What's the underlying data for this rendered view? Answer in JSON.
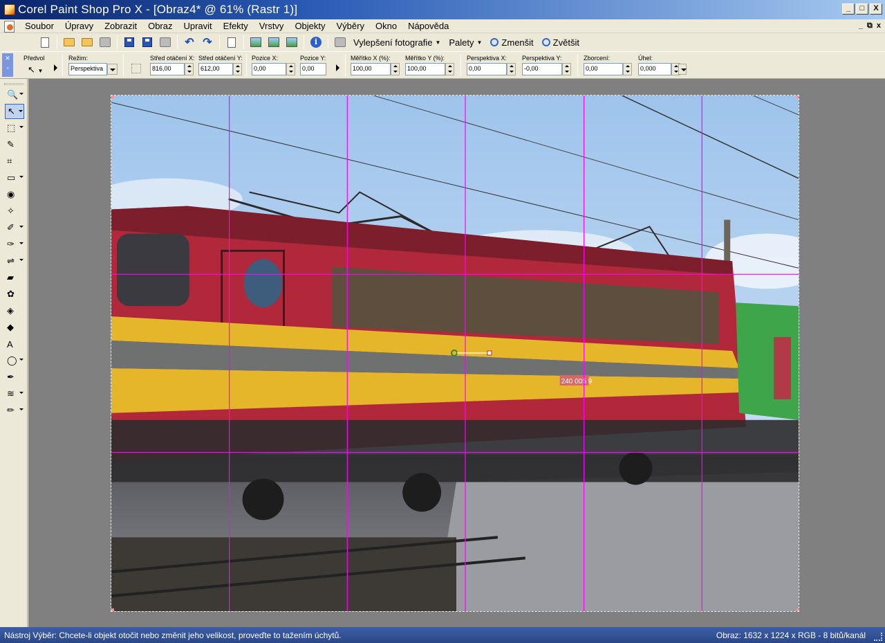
{
  "window": {
    "title": "Corel Paint Shop Pro X - [Obraz4* @  61% (Rastr 1)]",
    "min_label": "_",
    "max_label": "□",
    "close_label": "X"
  },
  "menu": {
    "items": [
      "Soubor",
      "Úpravy",
      "Zobrazit",
      "Obraz",
      "Upravit",
      "Efekty",
      "Vrstvy",
      "Objekty",
      "Výběry",
      "Okno",
      "Nápověda"
    ],
    "mdi": [
      "_",
      "⧉",
      "x"
    ]
  },
  "toolbar": {
    "enhance_label": "Vylepšení fotografie",
    "palettes_label": "Palety",
    "zoom_out_label": "Zmenšit",
    "zoom_in_label": "Zvětšit"
  },
  "tool_options": {
    "preset_label": "Předvol",
    "mode_label": "Režim:",
    "mode_value": "Perspektiva",
    "pivot_x_label": "Střed otáčení X:",
    "pivot_x_value": "816,00",
    "pivot_y_label": "Střed otáčení Y:",
    "pivot_y_value": "612,00",
    "pos_x_label": "Pozice X:",
    "pos_x_value": "0,00",
    "pos_y_label": "Pozice Y:",
    "pos_y_value": "0,00",
    "scale_x_label": "Měřítko X (%):",
    "scale_x_value": "100,00",
    "scale_y_label": "Měřítko Y (%):",
    "scale_y_value": "100,00",
    "persp_x_label": "Perspektiva X:",
    "persp_x_value": "0,00",
    "persp_y_label": "Perspektiva Y:",
    "persp_y_value": "-0,00",
    "shear_label": "Zborcení:",
    "shear_value": "0,00",
    "angle_label": "Úhel:",
    "angle_value": "0,000"
  },
  "tools": [
    {
      "icon": "zoom-icon",
      "glyph": "🔍"
    },
    {
      "icon": "pick-arrow-icon",
      "glyph": "↖"
    },
    {
      "icon": "selection-icon",
      "glyph": "⬚"
    },
    {
      "icon": "dropper-icon",
      "glyph": "✎"
    },
    {
      "icon": "crop-icon",
      "glyph": "⌗"
    },
    {
      "icon": "straighten-icon",
      "glyph": "▭"
    },
    {
      "icon": "red-eye-icon",
      "glyph": "◉"
    },
    {
      "icon": "clone-icon",
      "glyph": "✧"
    },
    {
      "icon": "brush-icon",
      "glyph": "✐"
    },
    {
      "icon": "smudge-icon",
      "glyph": "✑"
    },
    {
      "icon": "color-replacer-icon",
      "glyph": "⇌"
    },
    {
      "icon": "eraser-icon",
      "glyph": "▰"
    },
    {
      "icon": "picture-tube-icon",
      "glyph": "✿"
    },
    {
      "icon": "flood-fill-icon",
      "glyph": "◈"
    },
    {
      "icon": "object-select-icon",
      "glyph": "◆"
    },
    {
      "icon": "text-icon",
      "glyph": "A"
    },
    {
      "icon": "preset-shape-icon",
      "glyph": "◯"
    },
    {
      "icon": "pen-icon",
      "glyph": "✒"
    },
    {
      "icon": "warp-brush-icon",
      "glyph": "≋"
    },
    {
      "icon": "art-brush-icon",
      "glyph": "✏"
    }
  ],
  "canvas": {
    "grid_color": "#ff00ff",
    "number_plate": "240 005 9"
  },
  "status": {
    "message": "Nástroj Výběr: Chcete-li objekt otočit nebo změnit jeho velikost, proveďte to tažením úchytů.",
    "image_info": "Obraz:  1632 x 1224 x RGB - 8 bitů/kanál"
  }
}
